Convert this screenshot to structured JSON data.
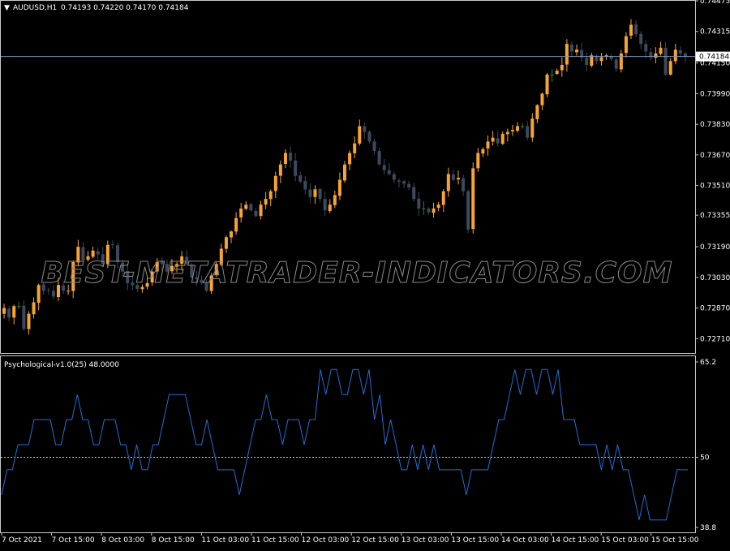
{
  "window": {
    "symbol_line": "AUDUSD,H1",
    "ohlc_text": "0.74193 0.74220 0.74170 0.74184"
  },
  "watermark": "BEST-METATRADER-INDICATORS.COM",
  "colors": {
    "background": "#000000",
    "grid_border": "#c8c8c8",
    "bull_candle": "#f7a432",
    "bear_candle": "#3b4a5c",
    "doji_candle": "#1f8a2a",
    "indicator_line": "#1f6fd6",
    "price_line": "#7f93b3",
    "level_line": "#c8c8c8",
    "watermark": "#8a8a8a"
  },
  "chart_data": [
    {
      "type": "candlestick",
      "title": "AUDUSD,H1",
      "ylim": [
        0.72635,
        0.74475
      ],
      "y_ticks": [
        "0.74475",
        "0.74315",
        "0.74150",
        "0.73990",
        "0.73830",
        "0.73670",
        "0.73510",
        "0.73355",
        "0.73190",
        "0.73030",
        "0.72870",
        "0.72710"
      ],
      "current_price_label": "0.74184",
      "current_price": 0.74184,
      "close_series": [
        0.7287,
        0.7282,
        0.7288,
        0.7288,
        0.7276,
        0.7284,
        0.729,
        0.7299,
        0.7296,
        0.7296,
        0.7293,
        0.7299,
        0.7296,
        0.7296,
        0.7311,
        0.7319,
        0.7312,
        0.7314,
        0.7317,
        0.7315,
        0.731,
        0.732,
        0.732,
        0.7311,
        0.7306,
        0.73,
        0.7299,
        0.7297,
        0.7298,
        0.73,
        0.7306,
        0.7311,
        0.731,
        0.7306,
        0.7309,
        0.731,
        0.7314,
        0.731,
        0.7303,
        0.7302,
        0.73,
        0.7296,
        0.7304,
        0.731,
        0.7318,
        0.7324,
        0.7327,
        0.7334,
        0.7339,
        0.7341,
        0.7338,
        0.7335,
        0.7341,
        0.7344,
        0.7348,
        0.7356,
        0.7362,
        0.7368,
        0.7364,
        0.7356,
        0.7353,
        0.7349,
        0.7345,
        0.7349,
        0.7344,
        0.7338,
        0.7341,
        0.7346,
        0.7354,
        0.7362,
        0.7368,
        0.7373,
        0.7382,
        0.7379,
        0.7374,
        0.7369,
        0.7362,
        0.7359,
        0.7357,
        0.7354,
        0.7353,
        0.7352,
        0.735,
        0.7344,
        0.7339,
        0.7339,
        0.7337,
        0.7339,
        0.7341,
        0.7348,
        0.7357,
        0.7354,
        0.7355,
        0.7348,
        0.7328,
        0.736,
        0.7368,
        0.737,
        0.7374,
        0.7376,
        0.7373,
        0.7378,
        0.7379,
        0.738,
        0.7382,
        0.7382,
        0.7376,
        0.7386,
        0.7393,
        0.7399,
        0.7409,
        0.7409,
        0.7411,
        0.7414,
        0.7425,
        0.7421,
        0.7422,
        0.7418,
        0.7414,
        0.7419,
        0.7416,
        0.7418,
        0.7419,
        0.7417,
        0.7412,
        0.742,
        0.7429,
        0.7435,
        0.743,
        0.7425,
        0.7421,
        0.7418,
        0.742,
        0.7423,
        0.7409,
        0.7416,
        0.7422,
        0.742,
        0.74184
      ]
    },
    {
      "type": "line",
      "title": "Psychological-v1.0(25) 48.0000",
      "ylim": [
        38.8,
        65.2
      ],
      "y_ticks": [
        "65.2",
        "50",
        "38.8"
      ],
      "level": 50,
      "series": [
        {
          "values": [
            44,
            48,
            48,
            52,
            52,
            52,
            56,
            56,
            56,
            56,
            52,
            52,
            56,
            56,
            60,
            56,
            56,
            52,
            52,
            56,
            56,
            56,
            52,
            52,
            48,
            52,
            48,
            48,
            52,
            52,
            56,
            60,
            60,
            60,
            60,
            56,
            52,
            52,
            56,
            52,
            48,
            48,
            48,
            48,
            44,
            48,
            52,
            56,
            56,
            60,
            56,
            56,
            52,
            56,
            56,
            56,
            52,
            56,
            56,
            64,
            60,
            64,
            64,
            60,
            60,
            64,
            64,
            60,
            64,
            56,
            60,
            52,
            56,
            52,
            48,
            48,
            52,
            48,
            52,
            48,
            52,
            48,
            48,
            48,
            48,
            48,
            44,
            48,
            48,
            48,
            48,
            52,
            56,
            56,
            60,
            64,
            60,
            64,
            64,
            60,
            64,
            64,
            60,
            64,
            56,
            56,
            56,
            52,
            52,
            52,
            52,
            48,
            52,
            48,
            52,
            48,
            48,
            44,
            40,
            44,
            40,
            40,
            40,
            40,
            44,
            48,
            48,
            48
          ]
        }
      ]
    }
  ],
  "time_axis": [
    "7 Oct 2021",
    "7 Oct 15:00",
    "8 Oct 03:00",
    "8 Oct 15:00",
    "11 Oct 03:00",
    "11 Oct 15:00",
    "12 Oct 03:00",
    "12 Oct 15:00",
    "13 Oct 03:00",
    "13 Oct 15:00",
    "14 Oct 03:00",
    "14 Oct 15:00",
    "15 Oct 03:00",
    "15 Oct 15:00"
  ]
}
